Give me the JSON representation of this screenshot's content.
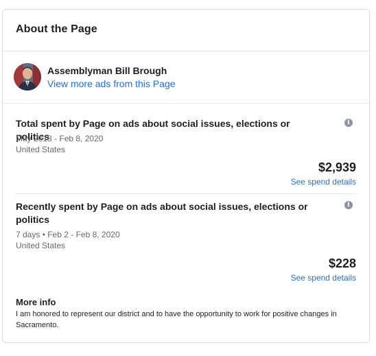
{
  "card": {
    "title": "About the Page"
  },
  "page": {
    "name": "Assemblyman Bill Brough",
    "link_label": "View more ads from this Page"
  },
  "total_spend": {
    "heading": "Total spent by Page on ads about social issues, elections or politics",
    "date_range": "May 2018 - Feb 8, 2020",
    "region": "United States",
    "amount": "$2,939",
    "details_label": "See spend details",
    "info_icon": "info-icon"
  },
  "recent_spend": {
    "heading": "Recently spent by Page on ads about social issues, elections or politics",
    "date_range": "7 days • Feb 2 - Feb 8, 2020",
    "region": "United States",
    "amount": "$228",
    "details_label": "See spend details",
    "info_icon": "info-icon"
  },
  "more_info": {
    "title": "More info",
    "text": "I am honored to represent our district and to have the opportunity to work for positive changes in Sacramento."
  },
  "colors": {
    "link": "#216fdb",
    "text": "#1c1e21",
    "secondary_text": "#65676b",
    "border": "#dadde1"
  }
}
